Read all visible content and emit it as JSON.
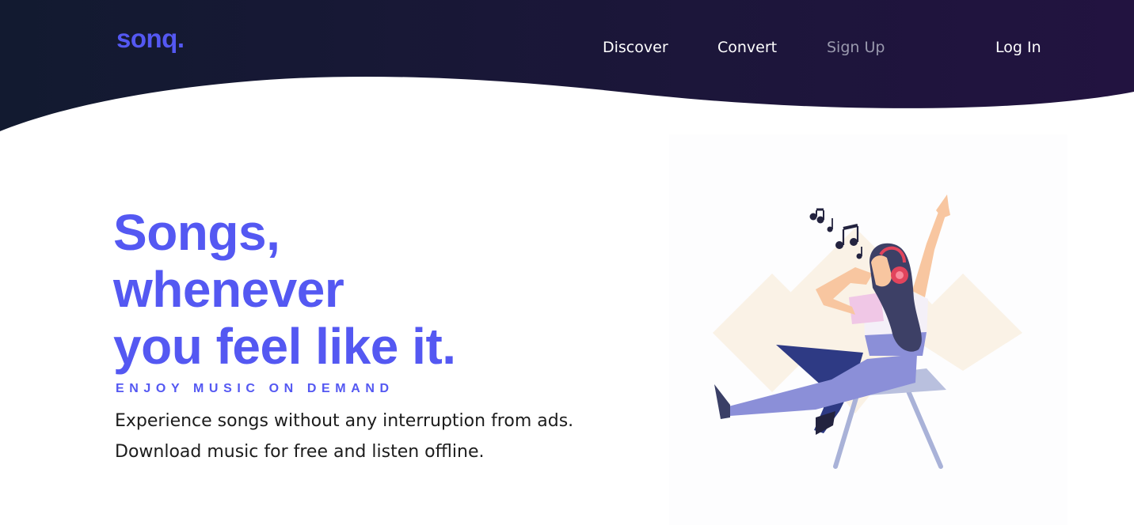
{
  "brand": {
    "logo_text": "sonq.",
    "accent_color": "#5458f2",
    "header_gradient": [
      "#121a30",
      "#221340"
    ]
  },
  "nav": {
    "items": [
      {
        "label": "Discover"
      },
      {
        "label": "Convert"
      },
      {
        "label": "Sign Up"
      },
      {
        "label": "Log In"
      }
    ]
  },
  "hero": {
    "title_lines": [
      "Songs,",
      "whenever",
      "you feel like it."
    ],
    "tagline": "ENJOY MUSIC ON DEMAND",
    "description_lines": [
      "Experience songs without any interruption from ads.",
      "Download music for free and listen offline."
    ]
  },
  "illustration": {
    "icon": "woman-listening-music-with-headphones-icon",
    "notes_icon": "music-notes-icon"
  }
}
